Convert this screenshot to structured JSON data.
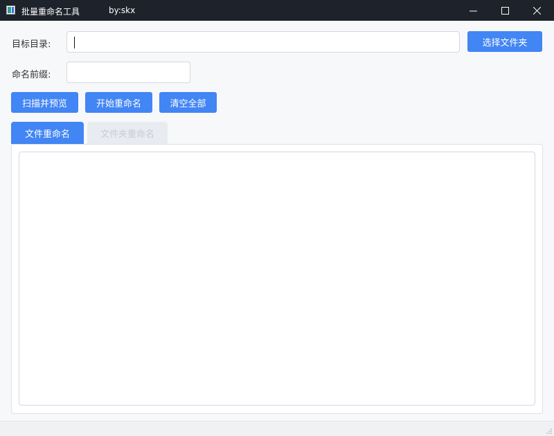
{
  "window": {
    "title": "批量重命名工具",
    "author": "by:skx",
    "icons": {
      "app": "app-icon",
      "minimize": "minimize-icon",
      "maximize": "maximize-icon",
      "close": "close-icon"
    }
  },
  "form": {
    "target_dir_label": "目标目录:",
    "target_dir_value": "",
    "choose_folder_label": "选择文件夹",
    "prefix_label": "命名前缀:",
    "prefix_value": ""
  },
  "actions": {
    "scan_preview": "扫描并预览",
    "start_rename": "开始重命名",
    "clear_all": "清空全部"
  },
  "tabs": [
    {
      "label": "文件重命名",
      "active": true
    },
    {
      "label": "文件夹重命名",
      "active": false
    }
  ],
  "preview_text": "",
  "colors": {
    "accent": "#4285f4",
    "titlebar": "#1e222b",
    "background": "#f7f8fa"
  }
}
